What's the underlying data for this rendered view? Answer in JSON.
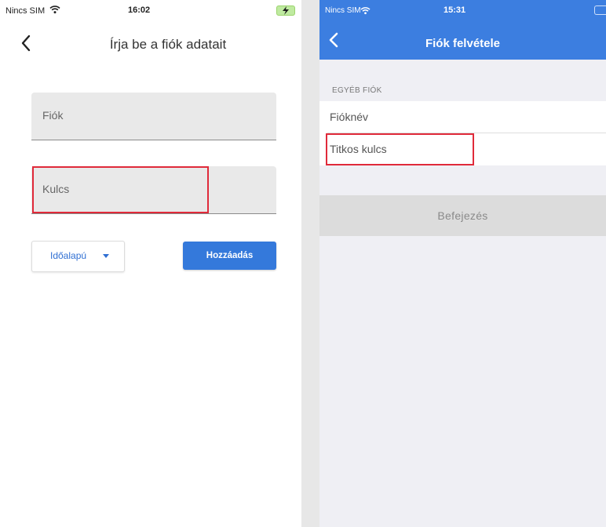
{
  "left_screen": {
    "status_bar": {
      "carrier": "Nincs SIM",
      "time": "16:02"
    },
    "nav": {
      "title": "Írja be a fiók adatait"
    },
    "fields": {
      "account_label": "Fiók",
      "key_label": "Kulcs"
    },
    "type_dropdown": {
      "selected": "Időalapú"
    },
    "add_button": {
      "label": "Hozzáadás"
    },
    "colors": {
      "accent": "#3479db",
      "highlight": "#e02a3a"
    }
  },
  "right_screen": {
    "status_bar": {
      "carrier": "Nincs SIM",
      "time": "15:31"
    },
    "nav": {
      "title": "Fiók felvétele"
    },
    "section_header": "EGYÉB FIÓK",
    "rows": [
      {
        "label": "Fióknév"
      },
      {
        "label": "Titkos kulcs"
      }
    ],
    "finish_button": {
      "label": "Befejezés"
    },
    "colors": {
      "header": "#3c7ee0",
      "highlight": "#e02a3a"
    }
  }
}
